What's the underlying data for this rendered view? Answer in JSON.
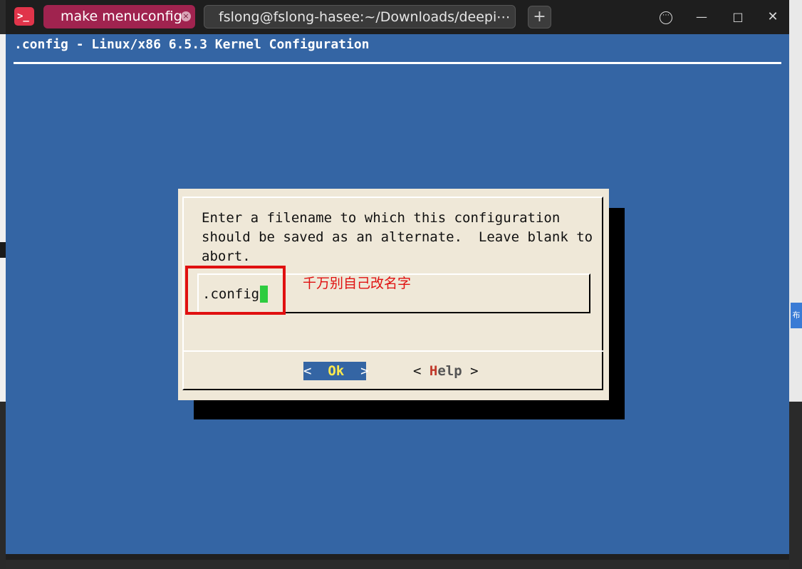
{
  "window": {
    "tabs": [
      {
        "label": "make menuconfig",
        "active": true
      },
      {
        "label": "fslong@fslong-hasee:~/Downloads/deepi⋯",
        "active": false
      }
    ],
    "app_icon": "terminal-icon",
    "buttons": {
      "new_tab": "+",
      "menu": "⋯",
      "minimize": "—",
      "maximize": "□",
      "close": "✕"
    }
  },
  "terminal": {
    "title": ".config - Linux/x86 6.5.3 Kernel Configuration"
  },
  "dialog": {
    "prompt_lines": [
      "Enter a filename to which this configuration",
      "should be saved as an alternate.  Leave blank to",
      "abort."
    ],
    "input_value": ".config",
    "annotation": "千万别自己改名字",
    "ok_button": {
      "left": "<",
      "hotkey": "O",
      "rest": "k",
      "right": ">"
    },
    "help_button": {
      "left": "<",
      "hotkey": "H",
      "rest": "elp",
      "right": ">"
    }
  },
  "background": {
    "right_tab_text": "布"
  },
  "colors": {
    "terminal_bg": "#3465a4",
    "dialog_bg": "#efe8d8",
    "active_tab": "#a0234f",
    "annotation_red": "#e01010",
    "cursor_green": "#2ecc40"
  }
}
